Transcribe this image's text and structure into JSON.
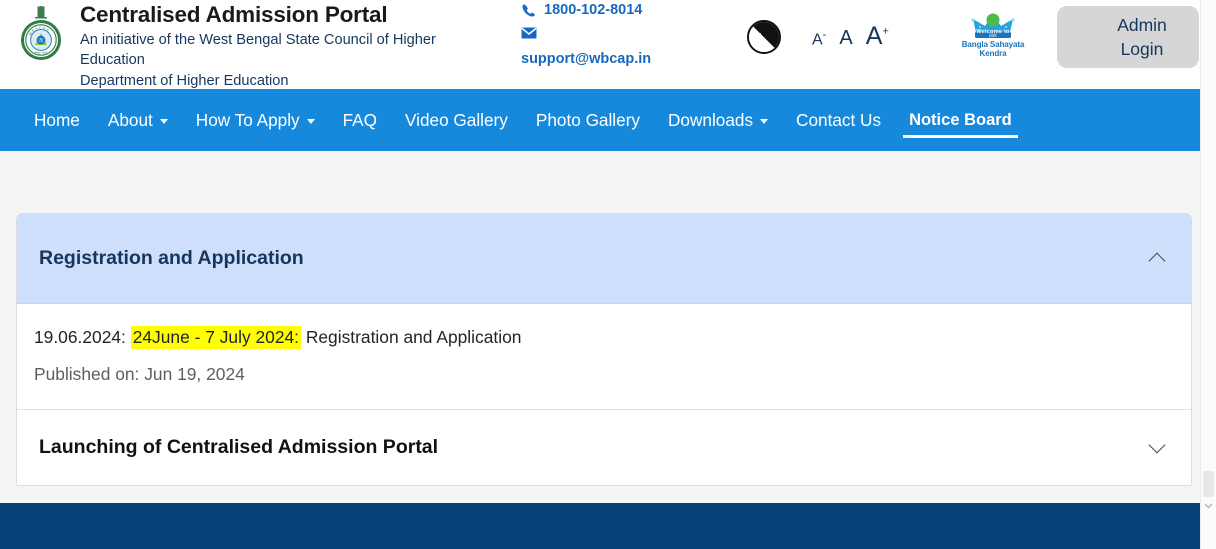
{
  "header": {
    "emblem_icon": "wbschse-emblem-icon",
    "title": "Centralised Admission Portal",
    "subtitle": "An initiative of the West Bengal State Council of Higher Education",
    "department": "Department of Higher Education",
    "phone": "1800-102-8014",
    "email": "support@wbcap.in",
    "phone_icon": "phone-icon",
    "mail_icon": "mail-icon",
    "contrast_icon": "contrast-toggle-icon",
    "font_decrease": "A",
    "font_decrease_sup": "-",
    "font_normal": "A",
    "font_increase": "A",
    "font_increase_sup": "+",
    "bsk_welcome": "Welcome to",
    "bsk_name": "Bangla Sahayata Kendra",
    "bsk_icon": "crown-icon",
    "admin_line1": "Admin",
    "admin_line2": "Login"
  },
  "nav": {
    "items": [
      {
        "label": "Home",
        "caret": false,
        "active": false
      },
      {
        "label": "About",
        "caret": true,
        "active": false
      },
      {
        "label": "How To Apply",
        "caret": true,
        "active": false
      },
      {
        "label": "FAQ",
        "caret": false,
        "active": false
      },
      {
        "label": "Video Gallery",
        "caret": false,
        "active": false
      },
      {
        "label": "Photo Gallery",
        "caret": false,
        "active": false
      },
      {
        "label": "Downloads",
        "caret": true,
        "active": false
      },
      {
        "label": "Contact Us",
        "caret": false,
        "active": false
      },
      {
        "label": "Notice Board",
        "caret": false,
        "active": true
      }
    ]
  },
  "notices": [
    {
      "title": "Registration and Application",
      "expanded": true,
      "chevron": "chevron-up-icon",
      "body_prefix": "19.06.2024: ",
      "body_highlight": "24June - 7 July 2024:",
      "body_suffix": " Registration and Application",
      "published": "Published on: Jun 19, 2024"
    },
    {
      "title": "Launching of Centralised Admission Portal",
      "expanded": false,
      "chevron": "chevron-down-icon"
    }
  ],
  "colors": {
    "nav_blue": "#1789dc",
    "accordion_blue": "#cddffa",
    "footer_navy": "#054079",
    "highlight_yellow": "#ffff00",
    "link_blue": "#1769c0",
    "navy_text": "#17365d"
  }
}
